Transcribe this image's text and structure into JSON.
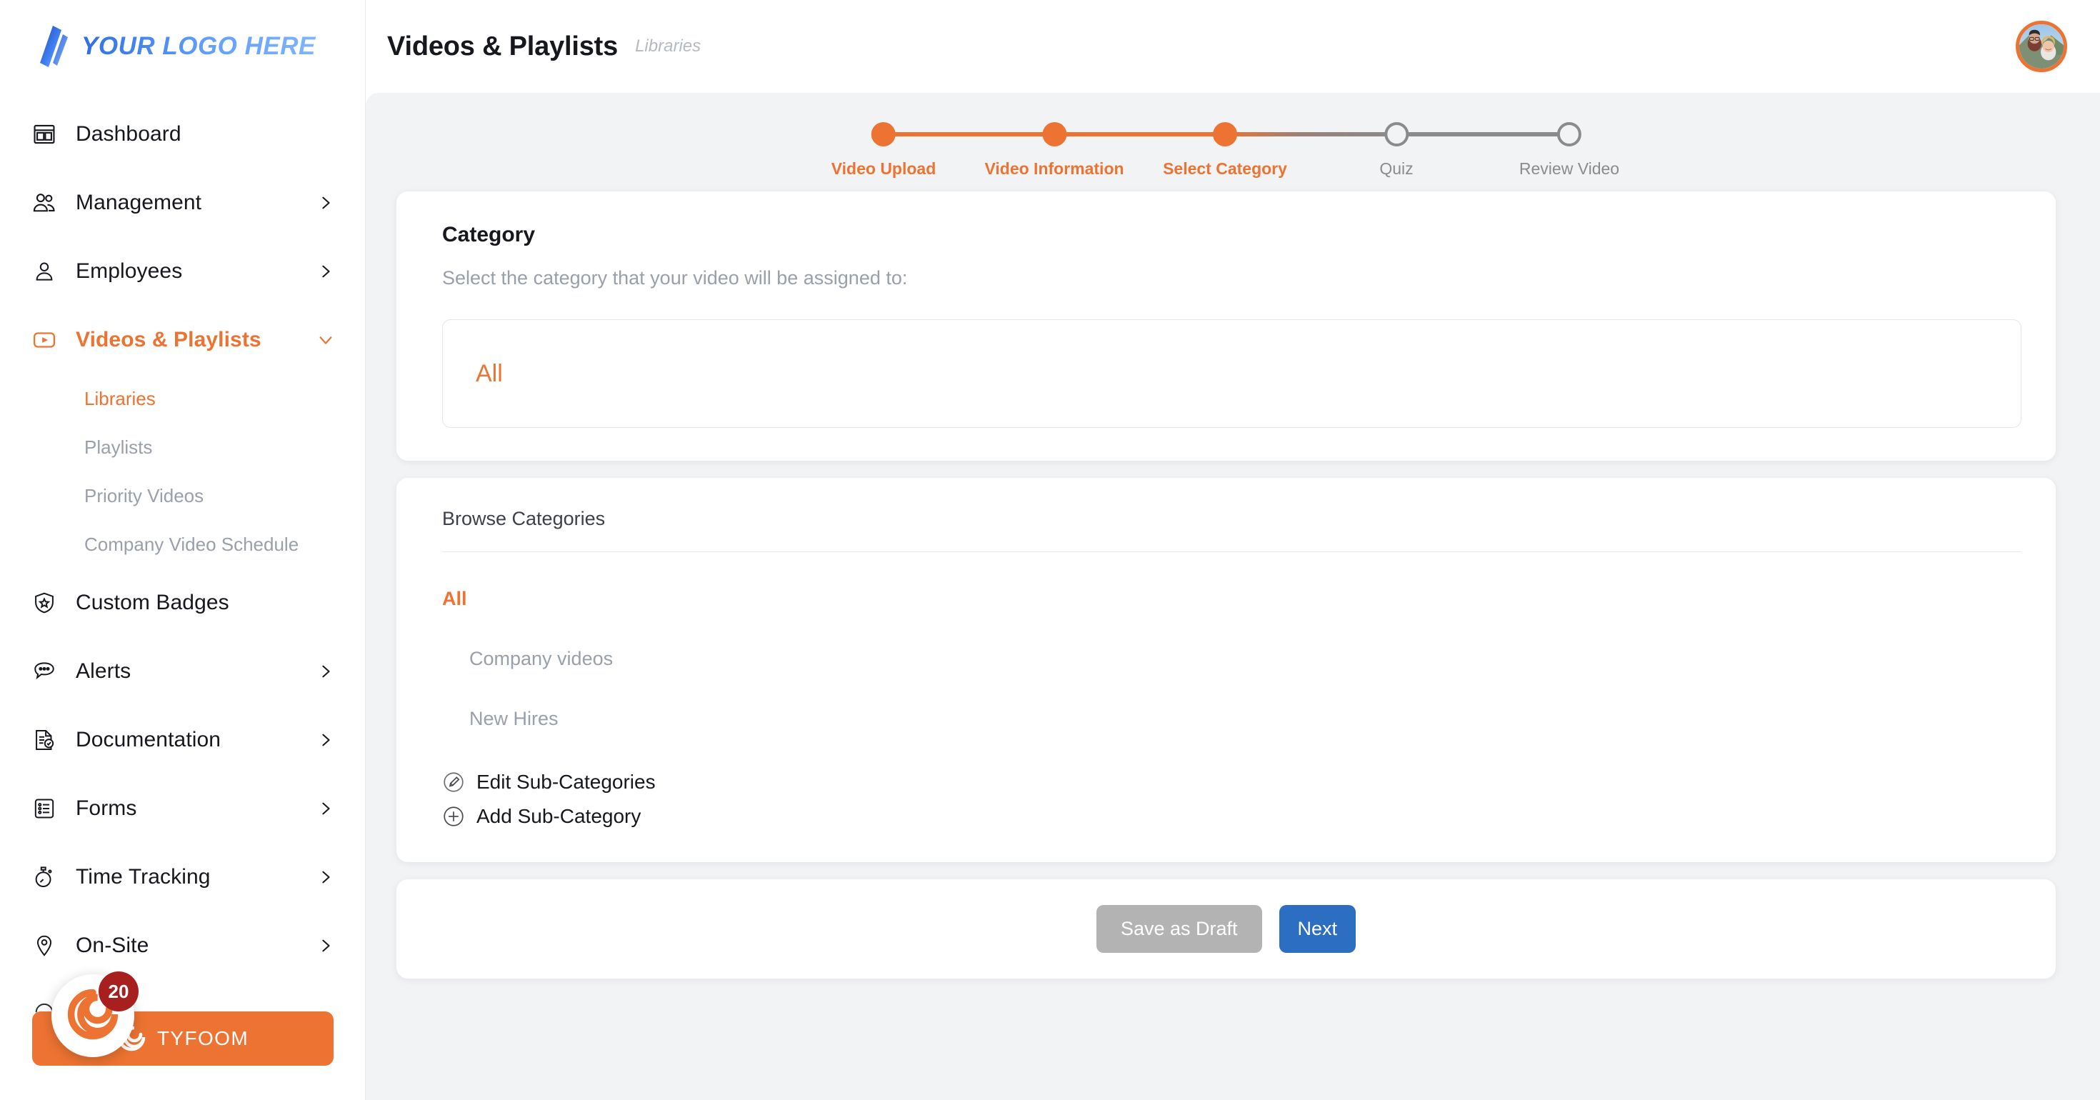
{
  "brand": {
    "logo_text": "YOUR LOGO HERE",
    "accent_orange": "#ED7332",
    "accent_blue": "#2c6ec2",
    "logo_blue": "#4a90f0"
  },
  "sidebar": {
    "items": [
      {
        "label": "Dashboard",
        "icon": "dashboard-icon",
        "has_chevron": false,
        "active": false
      },
      {
        "label": "Management",
        "icon": "users-group-icon",
        "has_chevron": true,
        "active": false
      },
      {
        "label": "Employees",
        "icon": "user-icon",
        "has_chevron": true,
        "active": false
      },
      {
        "label": "Videos & Playlists",
        "icon": "video-play-icon",
        "has_chevron": true,
        "active": true
      },
      {
        "label": "Custom Badges",
        "icon": "badge-shield-star-icon",
        "has_chevron": false,
        "active": false
      },
      {
        "label": "Alerts",
        "icon": "chat-bubble-dots-icon",
        "has_chevron": true,
        "active": false
      },
      {
        "label": "Documentation",
        "icon": "document-check-icon",
        "has_chevron": true,
        "active": false
      },
      {
        "label": "Forms",
        "icon": "form-list-icon",
        "has_chevron": true,
        "active": false
      },
      {
        "label": "Time Tracking",
        "icon": "stopwatch-icon",
        "has_chevron": true,
        "active": false
      },
      {
        "label": "On-Site",
        "icon": "map-pin-icon",
        "has_chevron": true,
        "active": false
      }
    ],
    "subitems": [
      {
        "label": "Libraries",
        "active": true
      },
      {
        "label": "Playlists",
        "active": false
      },
      {
        "label": "Priority Videos",
        "active": false
      },
      {
        "label": "Company Video Schedule",
        "active": false
      }
    ],
    "tyfoom": {
      "label": "TYFOOM",
      "badge_count": "20",
      "logo_icon": "tyfoom-swirl-icon"
    }
  },
  "header": {
    "title": "Videos & Playlists",
    "breadcrumb": "Libraries",
    "avatar_icon": "user-avatar-photo"
  },
  "stepper": {
    "steps": [
      {
        "label": "Video Upload",
        "state": "done"
      },
      {
        "label": "Video Information",
        "state": "done"
      },
      {
        "label": "Select Category",
        "state": "done"
      },
      {
        "label": "Quiz",
        "state": "todo"
      },
      {
        "label": "Review Video",
        "state": "todo"
      }
    ]
  },
  "category_card": {
    "title": "Category",
    "subtitle": "Select the category that your video will be assigned to:",
    "selected_value": "All"
  },
  "browse_card": {
    "title": "Browse Categories",
    "root_category": "All",
    "children": [
      {
        "label": "Company videos"
      },
      {
        "label": "New Hires"
      }
    ],
    "actions": [
      {
        "label": "Edit Sub-Categories",
        "icon": "pencil-circle-icon"
      },
      {
        "label": "Add Sub-Category",
        "icon": "plus-circle-icon"
      }
    ]
  },
  "footer": {
    "save_draft_label": "Save as Draft",
    "next_label": "Next"
  }
}
